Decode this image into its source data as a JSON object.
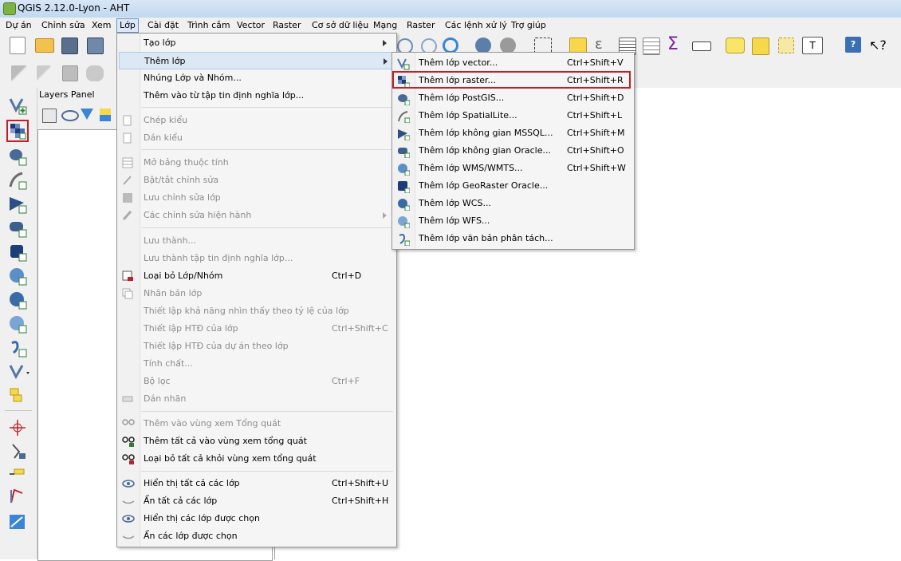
{
  "window": {
    "title": "QGIS 2.12.0-Lyon - AHT"
  },
  "menubar": [
    "Dự án",
    "Chỉnh sửa",
    "Xem",
    "Lớp",
    "Cài đặt",
    "Trình cắm",
    "Vector",
    "Raster",
    "Cơ sở dữ liệu",
    "Mạng",
    "Raster",
    "Các lệnh xử lý",
    "Trợ giúp"
  ],
  "layers_panel": {
    "title": "Layers Panel"
  },
  "layer_menu": [
    {
      "label": "Tạo lớp",
      "shortcut": "",
      "submenu": true,
      "disabled": false,
      "icon": ""
    },
    {
      "label": "Thêm lớp",
      "shortcut": "",
      "submenu": true,
      "disabled": false,
      "icon": "",
      "highlighted": true
    },
    {
      "label": "Nhúng Lớp và Nhóm...",
      "shortcut": "",
      "disabled": false,
      "icon": ""
    },
    {
      "label": "Thêm vào từ tập tin định nghĩa lớp...",
      "shortcut": "",
      "disabled": false,
      "icon": ""
    },
    {
      "label": "Chép kiểu",
      "shortcut": "",
      "disabled": true,
      "icon": "copy-style-icon"
    },
    {
      "label": "Dán kiểu",
      "shortcut": "",
      "disabled": true,
      "icon": "paste-style-icon"
    },
    {
      "label": "Mở bảng thuộc tính",
      "shortcut": "",
      "disabled": true,
      "icon": "attribute-table-icon"
    },
    {
      "label": "Bật/tắt chỉnh sửa",
      "shortcut": "",
      "disabled": true,
      "icon": "pencil-icon"
    },
    {
      "label": "Lưu chỉnh sửa lớp",
      "shortcut": "",
      "disabled": true,
      "icon": "save-edits-icon"
    },
    {
      "label": "Các chỉnh sửa hiện hành",
      "shortcut": "",
      "submenu": true,
      "disabled": true,
      "icon": "current-edits-icon"
    },
    {
      "label": "Lưu thành...",
      "shortcut": "",
      "disabled": true,
      "icon": ""
    },
    {
      "label": "Lưu thành tập tin định nghĩa lớp...",
      "shortcut": "",
      "disabled": true,
      "icon": ""
    },
    {
      "label": "Loại bỏ Lớp/Nhóm",
      "shortcut": "Ctrl+D",
      "disabled": false,
      "icon": "remove-layer-icon"
    },
    {
      "label": "Nhân bản lớp",
      "shortcut": "",
      "disabled": true,
      "icon": "duplicate-layer-icon"
    },
    {
      "label": "Thiết lập khả năng nhìn thấy theo tỷ lệ của lớp",
      "shortcut": "",
      "disabled": true,
      "icon": ""
    },
    {
      "label": "Thiết lập HTĐ của lớp",
      "shortcut": "Ctrl+Shift+C",
      "disabled": true,
      "icon": ""
    },
    {
      "label": "Thiết lập HTĐ của dự án theo lớp",
      "shortcut": "",
      "disabled": true,
      "icon": ""
    },
    {
      "label": "Tính chất...",
      "shortcut": "",
      "disabled": true,
      "icon": ""
    },
    {
      "label": "Bộ lọc",
      "shortcut": "Ctrl+F",
      "disabled": true,
      "icon": ""
    },
    {
      "label": "Dán nhãn",
      "shortcut": "",
      "disabled": true,
      "icon": "label-icon"
    },
    {
      "label": "Thêm vào vùng xem Tổng quát",
      "shortcut": "",
      "disabled": true,
      "icon": "overview-add-icon"
    },
    {
      "label": "Thêm tất cả vào vùng xem tổng quát",
      "shortcut": "",
      "disabled": false,
      "icon": "overview-add-all-icon"
    },
    {
      "label": "Loại bỏ tất cả khỏi vùng xem tổng quát",
      "shortcut": "",
      "disabled": false,
      "icon": "overview-remove-all-icon"
    },
    {
      "label": "Hiển thị tất cả các lớp",
      "shortcut": "Ctrl+Shift+U",
      "disabled": false,
      "icon": "eye-icon"
    },
    {
      "label": "Ẩn tất cả các lớp",
      "shortcut": "Ctrl+Shift+H",
      "disabled": false,
      "icon": "eye-closed-icon"
    },
    {
      "label": "Hiển thị các lớp được chọn",
      "shortcut": "",
      "disabled": false,
      "icon": "eye-icon"
    },
    {
      "label": "Ẩn các lớp được chọn",
      "shortcut": "",
      "disabled": false,
      "icon": "eye-closed-icon"
    }
  ],
  "add_layer_submenu": [
    {
      "label": "Thêm lớp vector...",
      "shortcut": "Ctrl+Shift+V",
      "icon": "vector-icon"
    },
    {
      "label": "Thêm lớp raster...",
      "shortcut": "Ctrl+Shift+R",
      "icon": "raster-icon",
      "highlighted": true
    },
    {
      "label": "Thêm lớp PostGIS...",
      "shortcut": "Ctrl+Shift+D",
      "icon": "postgis-icon"
    },
    {
      "label": "Thêm lớp SpatialLite...",
      "shortcut": "Ctrl+Shift+L",
      "icon": "spatialite-icon"
    },
    {
      "label": "Thêm lớp không gian MSSQL...",
      "shortcut": "Ctrl+Shift+M",
      "icon": "mssql-icon"
    },
    {
      "label": "Thêm lớp không gian Oracle...",
      "shortcut": "Ctrl+Shift+O",
      "icon": "oracle-icon"
    },
    {
      "label": "Thêm lớp WMS/WMTS...",
      "shortcut": "Ctrl+Shift+W",
      "icon": "wms-icon"
    },
    {
      "label": "Thêm lớp GeoRaster Oracle...",
      "shortcut": "",
      "icon": "georaster-icon"
    },
    {
      "label": "Thêm lớp WCS...",
      "shortcut": "",
      "icon": "wcs-icon"
    },
    {
      "label": "Thêm lớp WFS...",
      "shortcut": "",
      "icon": "wfs-icon"
    },
    {
      "label": "Thêm lớp văn bản phân tách...",
      "shortcut": "",
      "icon": "delimited-text-icon"
    }
  ],
  "colors": {
    "highlight_box": "#c0202a",
    "menu_hover": "#dde8f5"
  }
}
